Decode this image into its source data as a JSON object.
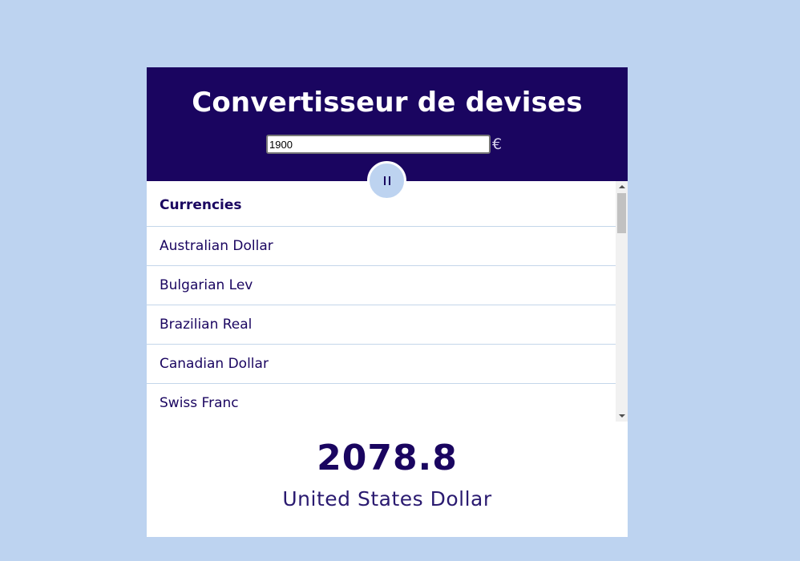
{
  "header": {
    "title": "Convertisseur de devises",
    "amount_value": "1900",
    "currency_symbol": "€"
  },
  "toggle": {
    "icon": "pause-icon"
  },
  "currency_list": {
    "header": "Currencies",
    "items": [
      "Australian Dollar",
      "Bulgarian Lev",
      "Brazilian Real",
      "Canadian Dollar",
      "Swiss Franc"
    ]
  },
  "result": {
    "value": "2078.8",
    "currency": "United States Dollar"
  },
  "colors": {
    "background": "#bdd3f0",
    "header_bg": "#1a0560",
    "text_primary": "#1a0560",
    "divider": "#c4d6ea"
  }
}
